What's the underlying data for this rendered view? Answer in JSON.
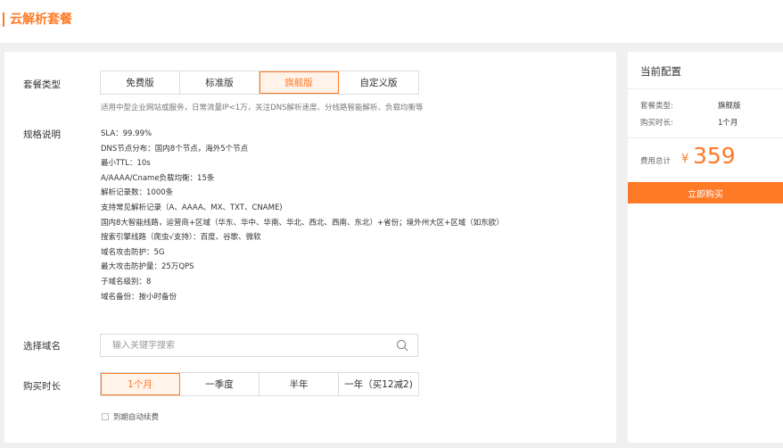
{
  "header": {
    "title": "云解析套餐"
  },
  "form": {
    "plan_type_label": "套餐类型",
    "plan_options": [
      "免费版",
      "标准版",
      "旗舰版",
      "自定义版"
    ],
    "plan_selected": "旗舰版",
    "plan_desc": "适用中型企业网站或服务，日常流量IP<1万，关注DNS解析速度、分线路智能解析、负载均衡等",
    "spec_label": "规格说明",
    "specs": [
      "SLA：99.99%",
      "DNS节点分布：国内8个节点，海外5个节点",
      "最小TTL：10s",
      "A/AAAA/Cname负载均衡：15条",
      "解析记录数：1000条",
      "支持常见解析记录（A、AAAA、MX、TXT、CNAME)",
      "国内8大智能线路，运营商+区域（华东、华中、华南、华北、西北、西南、东北）+省份；境外州大区+区域（如东欧）",
      "搜索引擎线路（爬虫√支持）：百度、谷歌、微软",
      "域名攻击防护：5G",
      "最大攻击防护量：25万QPS",
      "子域名级别：8",
      "域名备份：按小时备份"
    ],
    "domain_label": "选择域名",
    "domain_placeholder": "输入关键字搜索",
    "duration_label": "购买时长",
    "duration_options": [
      "1个月",
      "一季度",
      "半年",
      "一年（买12减2)"
    ],
    "duration_selected": "1个月",
    "auto_renew_label": "到期自动续费",
    "auto_renew_checked": false
  },
  "sidebar": {
    "title": "当前配置",
    "plan_type_label": "套餐类型:",
    "plan_type_value": "旗舰版",
    "duration_label": "购买时长:",
    "duration_value": "1个月",
    "fee_label": "费用总计",
    "currency": "¥",
    "price": "359",
    "buy_button": "立即购买"
  },
  "colors": {
    "accent": "#ff7a26",
    "accent_bg": "#fff3ea"
  }
}
